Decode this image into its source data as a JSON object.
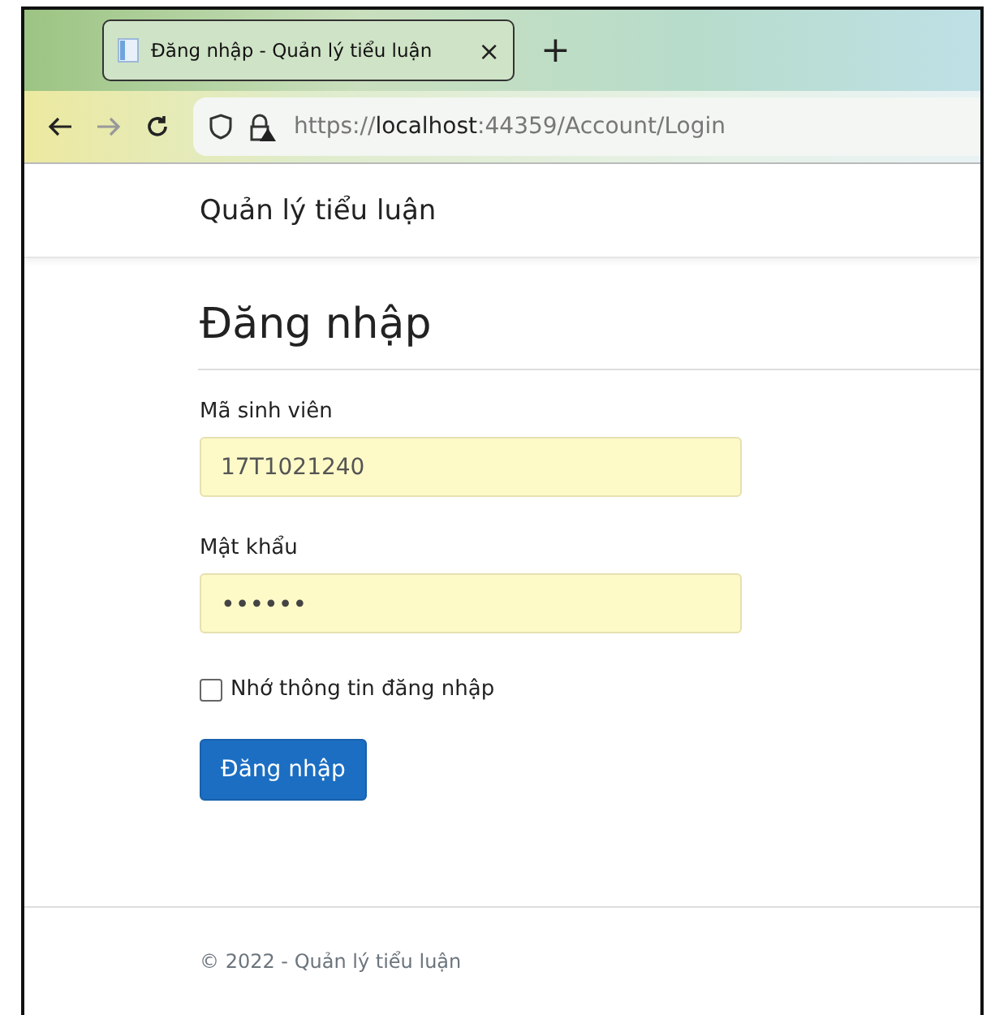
{
  "browser": {
    "tab": {
      "title": "Đăng nhập - Quản lý tiểu luận",
      "close": "×",
      "selected": true
    },
    "new_tab": "+",
    "url": {
      "scheme": "https://",
      "host": "localhost",
      "rest": ":44359/Account/Login"
    }
  },
  "navbar": {
    "brand": "Quản lý tiểu luận"
  },
  "form": {
    "heading": "Đăng nhập",
    "fields": [
      {
        "label": "Mã sinh viên",
        "value": "17T1021240",
        "kind": "text"
      },
      {
        "label": "Mật khẩu",
        "value": "••••••",
        "kind": "password"
      }
    ],
    "remember": {
      "label": "Nhớ thông tin đăng nhập",
      "checked": false
    },
    "submit": "Đăng nhập"
  },
  "footer": {
    "text": "© 2022 - Quản lý tiểu luận"
  }
}
